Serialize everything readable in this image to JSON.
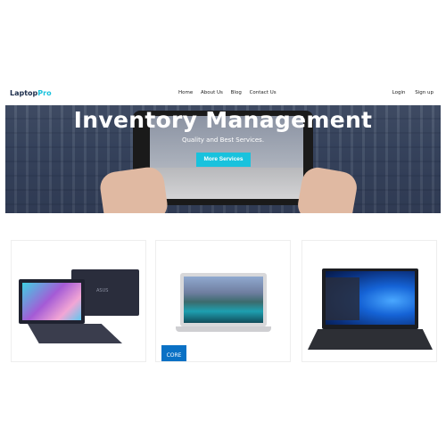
{
  "brand": {
    "part1": "Laptop",
    "part2": "Pro"
  },
  "nav": {
    "links": [
      "Home",
      "About Us",
      "Blog",
      "Contact Us"
    ],
    "auth": [
      "Login",
      "Sign up"
    ]
  },
  "hero": {
    "title": "Inventory Management",
    "subtitle": "Quality and Best Services.",
    "button": "More Services"
  },
  "products": [
    {
      "logo_text": "ASUS"
    },
    {
      "badge_text": "CORE"
    },
    {}
  ],
  "colors": {
    "accent": "#19c2dd",
    "brand_dark": "#1b2c4a"
  }
}
